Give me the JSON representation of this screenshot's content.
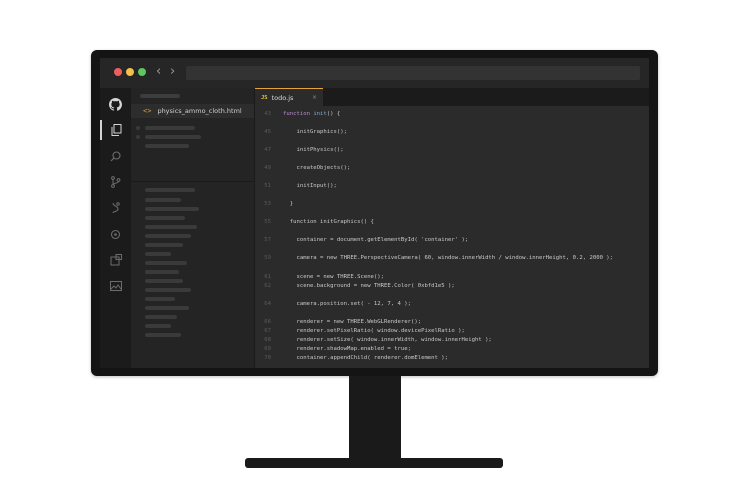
{
  "browser": {
    "nav_back": "‹",
    "nav_forward": "›"
  },
  "activity_bar": {
    "icons": [
      "github-icon",
      "files-icon",
      "search-icon",
      "source-control-icon",
      "debug-icon",
      "extensions-icon",
      "settings-icon",
      "image-icon"
    ]
  },
  "sidebar": {
    "file_icon": "<>",
    "file_name": "physics_ammo_cloth.html"
  },
  "tab": {
    "icon": "JS",
    "label": "todo.js",
    "close": "×"
  },
  "code_lines": [
    {
      "ln": "43",
      "parts": [
        {
          "t": "function ",
          "c": "kw"
        },
        {
          "t": "init",
          "c": "fn-name"
        },
        {
          "t": "() {",
          "c": ""
        }
      ]
    },
    {
      "ln": "45",
      "parts": [
        {
          "t": "    initGraphics();",
          "c": ""
        }
      ]
    },
    {
      "ln": "47",
      "parts": [
        {
          "t": "    initPhysics();",
          "c": ""
        }
      ]
    },
    {
      "ln": "49",
      "parts": [
        {
          "t": "    createObjects();",
          "c": ""
        }
      ]
    },
    {
      "ln": "51",
      "parts": [
        {
          "t": "    initInput();",
          "c": ""
        }
      ]
    },
    {
      "ln": "53",
      "parts": [
        {
          "t": "  }",
          "c": ""
        }
      ]
    },
    {
      "ln": "55",
      "parts": [
        {
          "t": "  function initGraphics() {",
          "c": ""
        }
      ]
    },
    {
      "ln": "57",
      "parts": [
        {
          "t": "    container = document.getElementById( 'container' );",
          "c": ""
        }
      ]
    },
    {
      "ln": "59",
      "parts": [
        {
          "t": "    camera = new THREE.PerspectiveCamera( 60, window.innerWidth / window.innerHeight, 0.2, 2000 );",
          "c": ""
        }
      ]
    },
    {
      "ln": "61",
      "parts": [
        {
          "t": "    scene = new THREE.Scene();",
          "c": ""
        }
      ]
    },
    {
      "ln": "62",
      "parts": [
        {
          "t": "    scene.background = new THREE.Color( 0xbfd1e5 );",
          "c": ""
        }
      ]
    },
    {
      "ln": "64",
      "parts": [
        {
          "t": "    camera.position.set( - 12, 7, 4 );",
          "c": ""
        }
      ]
    },
    {
      "ln": "66",
      "parts": [
        {
          "t": "    renderer = new THREE.WebGLRenderer();",
          "c": ""
        }
      ]
    },
    {
      "ln": "67",
      "parts": [
        {
          "t": "    renderer.setPixelRatio( window.devicePixelRatio );",
          "c": ""
        }
      ]
    },
    {
      "ln": "68",
      "parts": [
        {
          "t": "    renderer.setSize( window.innerWidth, window.innerHeight );",
          "c": ""
        }
      ]
    },
    {
      "ln": "69",
      "parts": [
        {
          "t": "    renderer.shadowMap.enabled = true;",
          "c": ""
        }
      ]
    },
    {
      "ln": "70",
      "parts": [
        {
          "t": "    container.appendChild( renderer.domElement );",
          "c": ""
        }
      ]
    }
  ]
}
